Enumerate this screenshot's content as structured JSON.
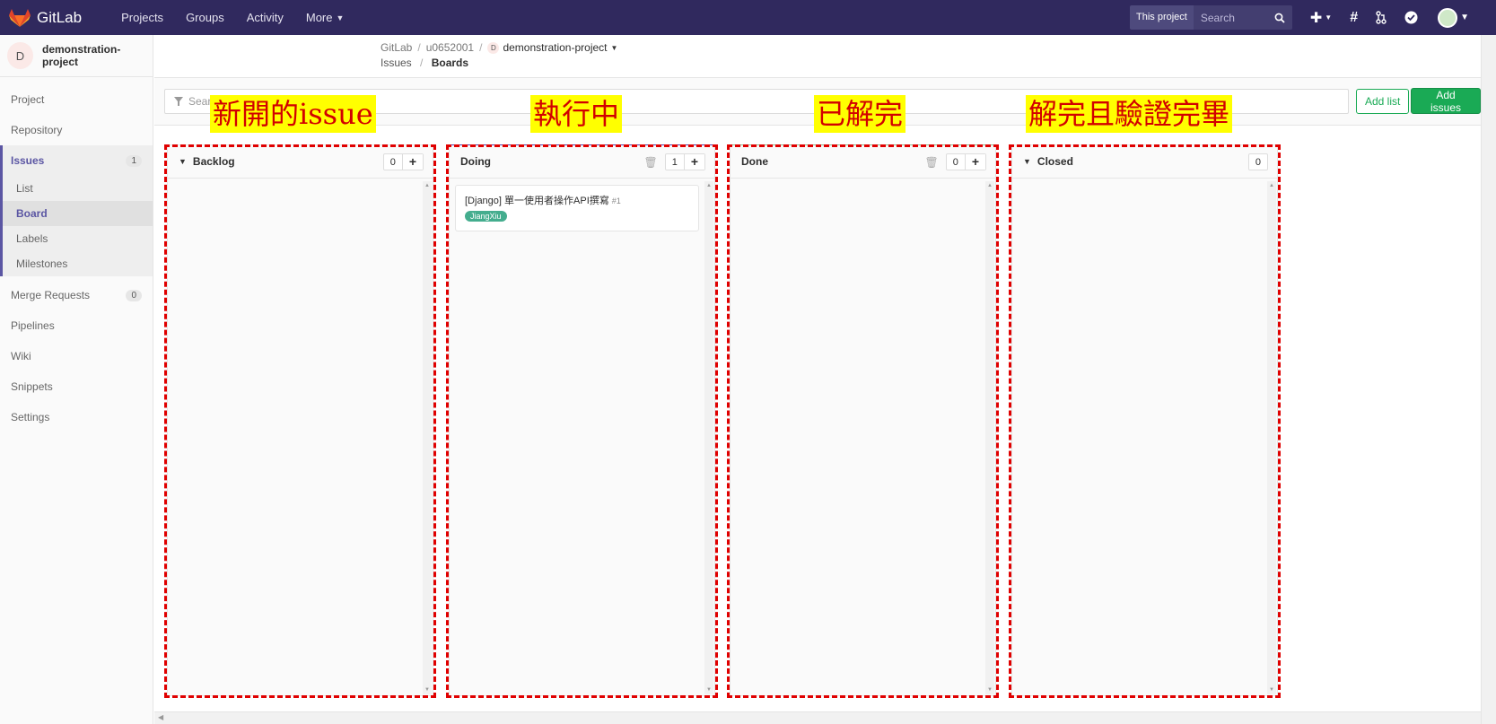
{
  "nav": {
    "brand": "GitLab",
    "links": [
      "Projects",
      "Groups",
      "Activity",
      "More"
    ],
    "search_scope": "This project",
    "search_placeholder": "Search",
    "icons": [
      "plus-icon",
      "hash-icon",
      "merge-request-icon",
      "todo-check-icon",
      "user-avatar"
    ]
  },
  "sidebar": {
    "project_initial": "D",
    "project_name": "demonstration-project",
    "items": [
      {
        "label": "Project"
      },
      {
        "label": "Repository"
      },
      {
        "label": "Issues",
        "count": "1",
        "active": true
      },
      {
        "label": "Merge Requests",
        "count": "0"
      },
      {
        "label": "Pipelines"
      },
      {
        "label": "Wiki"
      },
      {
        "label": "Snippets"
      },
      {
        "label": "Settings"
      }
    ],
    "issues_sub": [
      "List",
      "Board",
      "Labels",
      "Milestones"
    ]
  },
  "breadcrumbs": {
    "root": "GitLab",
    "user": "u0652001",
    "project_initial": "D",
    "project": "demonstration-project",
    "section": "Issues",
    "page": "Boards"
  },
  "filter": {
    "placeholder": "Search or filter results...",
    "add_list": "Add list",
    "add_issues": "Add issues"
  },
  "boards": [
    {
      "title": "Backlog",
      "count": "0"
    },
    {
      "title": "Doing",
      "count": "1",
      "color": "#5843ad"
    },
    {
      "title": "Done",
      "count": "0",
      "color": "#8fbc8f"
    },
    {
      "title": "Closed",
      "count": "0"
    }
  ],
  "card": {
    "title": "[Django] 單一使用者操作API撰寫",
    "ref": "#1",
    "label": "JiangXiu",
    "label_color": "#44ad8e"
  },
  "annotations": [
    "新開的issue",
    "執行中",
    "已解完",
    "解完且驗證完畢"
  ]
}
